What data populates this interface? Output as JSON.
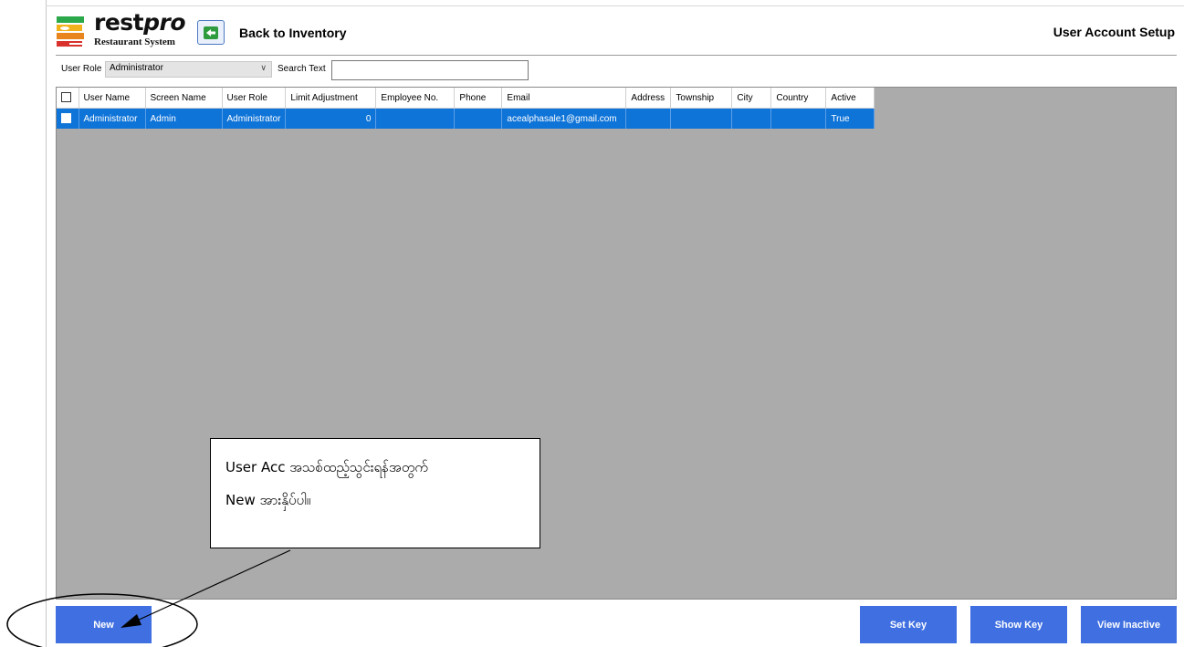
{
  "header": {
    "logo_word": "rest",
    "logo_word_italic": "pro",
    "logo_subtitle": "Restaurant System",
    "back_label": "Back to Inventory",
    "page_title": "User Account Setup"
  },
  "filters": {
    "role_label": "User Role",
    "role_value": "Administrator",
    "search_label": "Search Text",
    "search_value": ""
  },
  "grid": {
    "columns": [
      "User Name",
      "Screen Name",
      "User Role",
      "Limit Adjustment",
      "Employee No.",
      "Phone",
      "Email",
      "Address",
      "Township",
      "City",
      "Country",
      "Active"
    ],
    "rows": [
      {
        "user_name": "Administrator",
        "screen_name": "Admin",
        "user_role": "Administrator",
        "limit_adjustment": "0",
        "employee_no": "",
        "phone": "",
        "email": "acealphasale1@gmail.com",
        "address": "",
        "township": "",
        "city": "",
        "country": "",
        "active": "True"
      }
    ]
  },
  "callout": {
    "line1": "User Acc အသစ်ထည့်သွင်းရန်အတွက်",
    "line2": "New အားနှိပ်ပါ။"
  },
  "buttons": {
    "new": "New",
    "set_key": "Set Key",
    "show_key": "Show Key",
    "view_inactive": "View Inactive"
  },
  "colors": {
    "selected_row": "#0f74d8",
    "button": "#3f6fe0",
    "grid_background": "#ababab"
  }
}
